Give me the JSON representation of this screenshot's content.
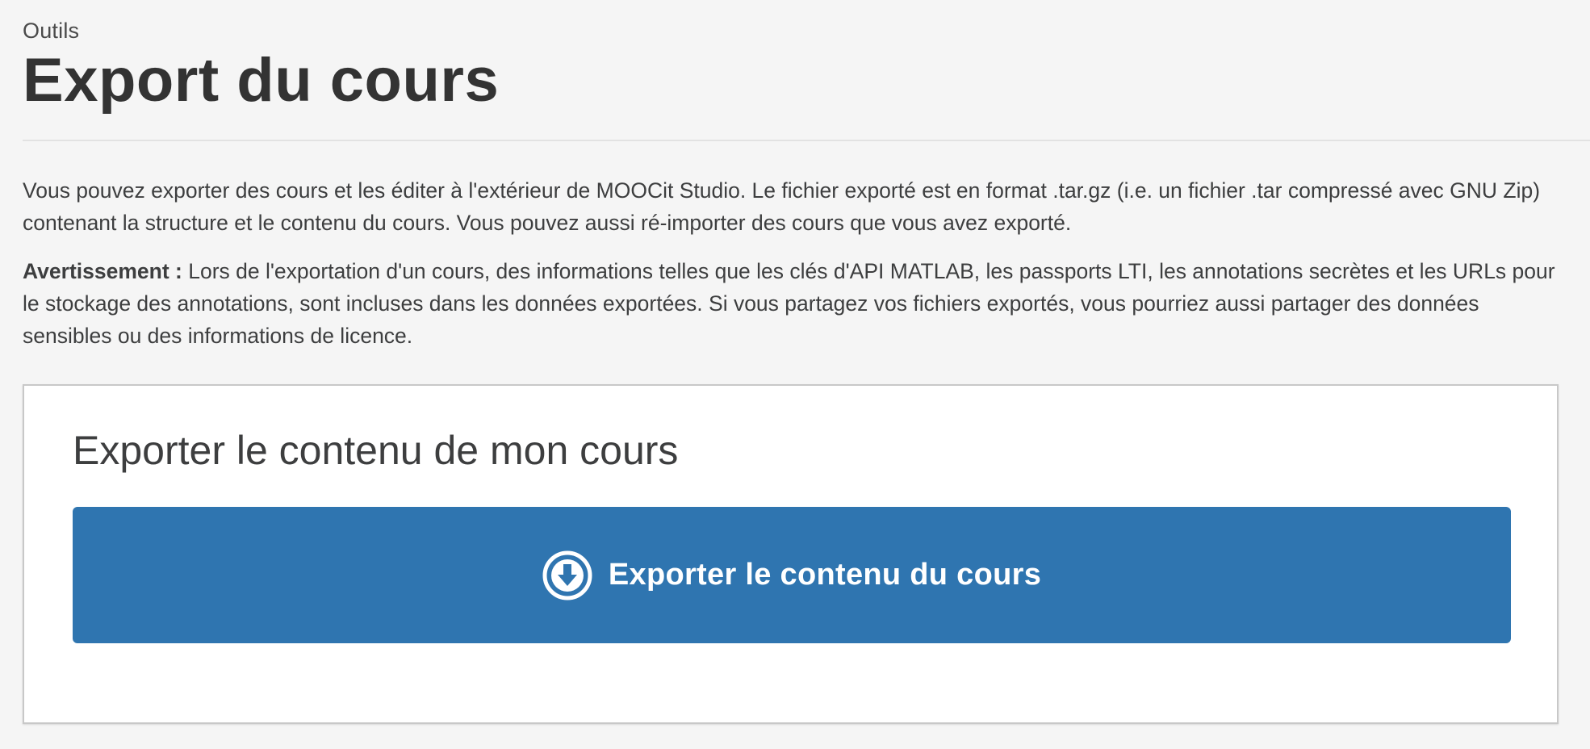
{
  "header": {
    "breadcrumb": "Outils",
    "title": "Export du cours"
  },
  "intro": {
    "description": "Vous pouvez exporter des cours et les éditer à l'extérieur de MOOCit Studio. Le fichier exporté est en format .tar.gz (i.e. un fichier .tar compressé avec GNU Zip) contenant la structure et le contenu du cours. Vous pouvez aussi ré-importer des cours que vous avez exporté.",
    "warning_label": "Avertissement :",
    "warning_text": " Lors de l'exportation d'un cours, des informations telles que les clés d'API MATLAB, les passports LTI, les annotations secrètes et les URLs pour le stockage des annotations, sont incluses dans les données exportées. Si vous partagez vos fichiers exportés, vous pourriez aussi partager des données sensibles ou des informations de licence."
  },
  "export_card": {
    "title": "Exporter le contenu de mon cours",
    "button_label": "Exporter le contenu du cours",
    "button_icon": "arrow-circle-down-icon"
  },
  "colors": {
    "background": "#f5f5f5",
    "primary_button": "#2f75b0",
    "text": "#3d3e3f"
  }
}
